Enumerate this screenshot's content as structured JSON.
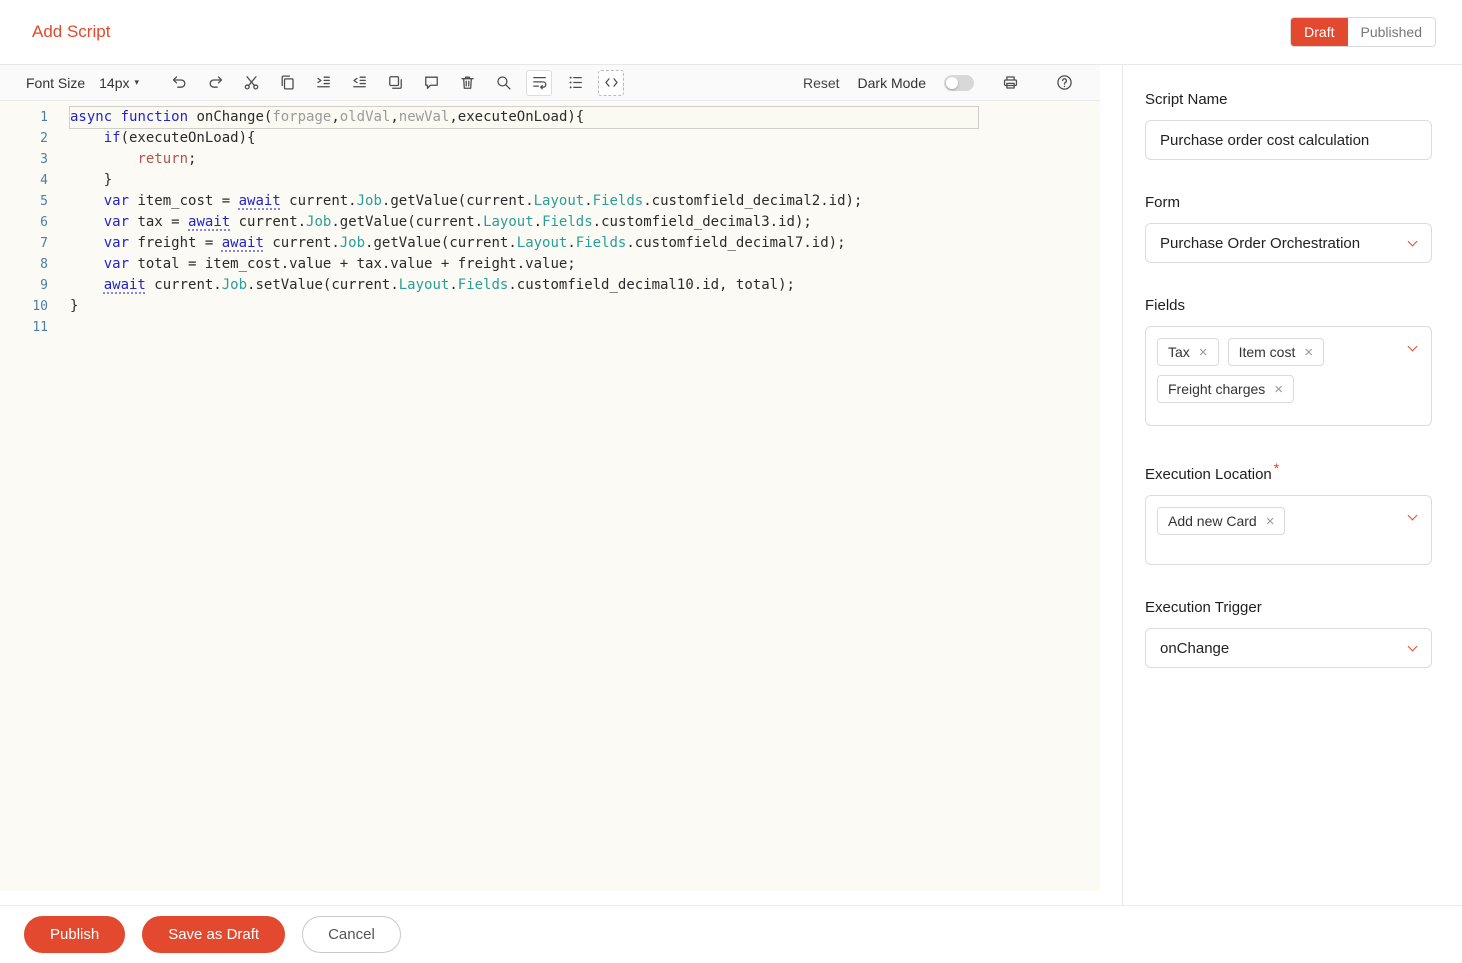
{
  "colors": {
    "accent": "#e2492f",
    "editor_bg": "#fbfaf4",
    "keyword": "#2323cc",
    "property": "#2a9f96",
    "parameter": "#9a9a9a",
    "return_kw": "#b0544c",
    "line_number": "#4a7fa8"
  },
  "header": {
    "title": "Add Script",
    "draft_label": "Draft",
    "published_label": "Published"
  },
  "toolbar": {
    "font_size_label": "Font Size",
    "font_size_value": "14px",
    "reset_label": "Reset",
    "dark_mode_label": "Dark Mode",
    "icons": [
      "undo-icon",
      "redo-icon",
      "cut-icon",
      "copy-icon",
      "indent-icon",
      "outdent-icon",
      "duplicate-icon",
      "comment-icon",
      "delete-icon",
      "search-icon",
      "wrap-lines-icon",
      "ordered-list-icon",
      "code-block-icon",
      "print-icon",
      "help-icon"
    ]
  },
  "editor": {
    "lines": [
      [
        [
          "kw",
          "async"
        ],
        [
          "pl",
          " "
        ],
        [
          "kw",
          "function"
        ],
        [
          "pl",
          " onChange("
        ],
        [
          "pm",
          "forpage"
        ],
        [
          "pl",
          ","
        ],
        [
          "pm",
          "oldVal"
        ],
        [
          "pl",
          ","
        ],
        [
          "pm",
          "newVal"
        ],
        [
          "pl",
          ",executeOnLoad){"
        ]
      ],
      [
        [
          "pl",
          "    "
        ],
        [
          "kw",
          "if"
        ],
        [
          "pl",
          "(executeOnLoad){"
        ]
      ],
      [
        [
          "pl",
          "        "
        ],
        [
          "rt",
          "return"
        ],
        [
          "pl",
          ";"
        ]
      ],
      [
        [
          "pl",
          "    }"
        ]
      ],
      [
        [
          "pl",
          "    "
        ],
        [
          "kw",
          "var"
        ],
        [
          "pl",
          " item_cost = "
        ],
        [
          "aw",
          "await"
        ],
        [
          "pl",
          " current."
        ],
        [
          "pr",
          "Job"
        ],
        [
          "pl",
          ".getValue(current."
        ],
        [
          "pr",
          "Layout"
        ],
        [
          "pl",
          "."
        ],
        [
          "pr",
          "Fields"
        ],
        [
          "pl",
          ".customfield_decimal2.id);"
        ]
      ],
      [
        [
          "pl",
          "    "
        ],
        [
          "kw",
          "var"
        ],
        [
          "pl",
          " tax = "
        ],
        [
          "aw",
          "await"
        ],
        [
          "pl",
          " current."
        ],
        [
          "pr",
          "Job"
        ],
        [
          "pl",
          ".getValue(current."
        ],
        [
          "pr",
          "Layout"
        ],
        [
          "pl",
          "."
        ],
        [
          "pr",
          "Fields"
        ],
        [
          "pl",
          ".customfield_decimal3.id);"
        ]
      ],
      [
        [
          "pl",
          "    "
        ],
        [
          "kw",
          "var"
        ],
        [
          "pl",
          " freight = "
        ],
        [
          "aw",
          "await"
        ],
        [
          "pl",
          " current."
        ],
        [
          "pr",
          "Job"
        ],
        [
          "pl",
          ".getValue(current."
        ],
        [
          "pr",
          "Layout"
        ],
        [
          "pl",
          "."
        ],
        [
          "pr",
          "Fields"
        ],
        [
          "pl",
          ".customfield_decimal7.id);"
        ]
      ],
      [
        [
          "pl",
          "    "
        ],
        [
          "kw",
          "var"
        ],
        [
          "pl",
          " total = item_cost.value + tax.value + freight.value;"
        ]
      ],
      [
        [
          "pl",
          "    "
        ],
        [
          "aw",
          "await"
        ],
        [
          "pl",
          " current."
        ],
        [
          "pr",
          "Job"
        ],
        [
          "pl",
          ".setValue(current."
        ],
        [
          "pr",
          "Layout"
        ],
        [
          "pl",
          "."
        ],
        [
          "pr",
          "Fields"
        ],
        [
          "pl",
          ".customfield_decimal10.id, total);"
        ]
      ],
      [
        [
          "pl",
          "}"
        ]
      ],
      []
    ]
  },
  "panel": {
    "script_name": {
      "label": "Script Name",
      "value": "Purchase order cost calculation"
    },
    "form": {
      "label": "Form",
      "value": "Purchase Order Orchestration"
    },
    "fields": {
      "label": "Fields",
      "chips": [
        "Tax",
        "Item cost",
        "Freight charges"
      ]
    },
    "execution_location": {
      "label": "Execution Location",
      "required_mark": "*",
      "chips": [
        "Add new Card"
      ]
    },
    "execution_trigger": {
      "label": "Execution Trigger",
      "value": "onChange"
    }
  },
  "footer": {
    "publish_label": "Publish",
    "save_draft_label": "Save as Draft",
    "cancel_label": "Cancel"
  }
}
